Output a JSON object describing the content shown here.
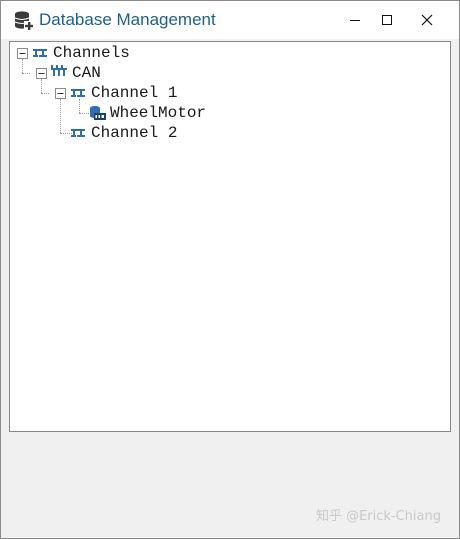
{
  "window": {
    "title": "Database Management",
    "icon": "database-add-icon",
    "controls": [
      "minimize-icon",
      "maximize-icon",
      "close-icon"
    ]
  },
  "tree": {
    "root": {
      "label": "Channels",
      "icon": "channel-icon",
      "expanded": true,
      "children": [
        {
          "label": "CAN",
          "icon": "bus-icon",
          "expanded": true,
          "children": [
            {
              "label": "Channel 1",
              "icon": "channel-icon",
              "expanded": true,
              "children": [
                {
                  "label": "WheelMotor",
                  "icon": "dbc-file-icon"
                }
              ]
            },
            {
              "label": "Channel 2",
              "icon": "channel-icon"
            }
          ]
        }
      ]
    }
  },
  "watermark": "知乎 @Erick-Chiang",
  "colors": {
    "title_text": "#1c5f8f",
    "tree_border": "#828790",
    "icon_blue": "#2f6db5"
  }
}
